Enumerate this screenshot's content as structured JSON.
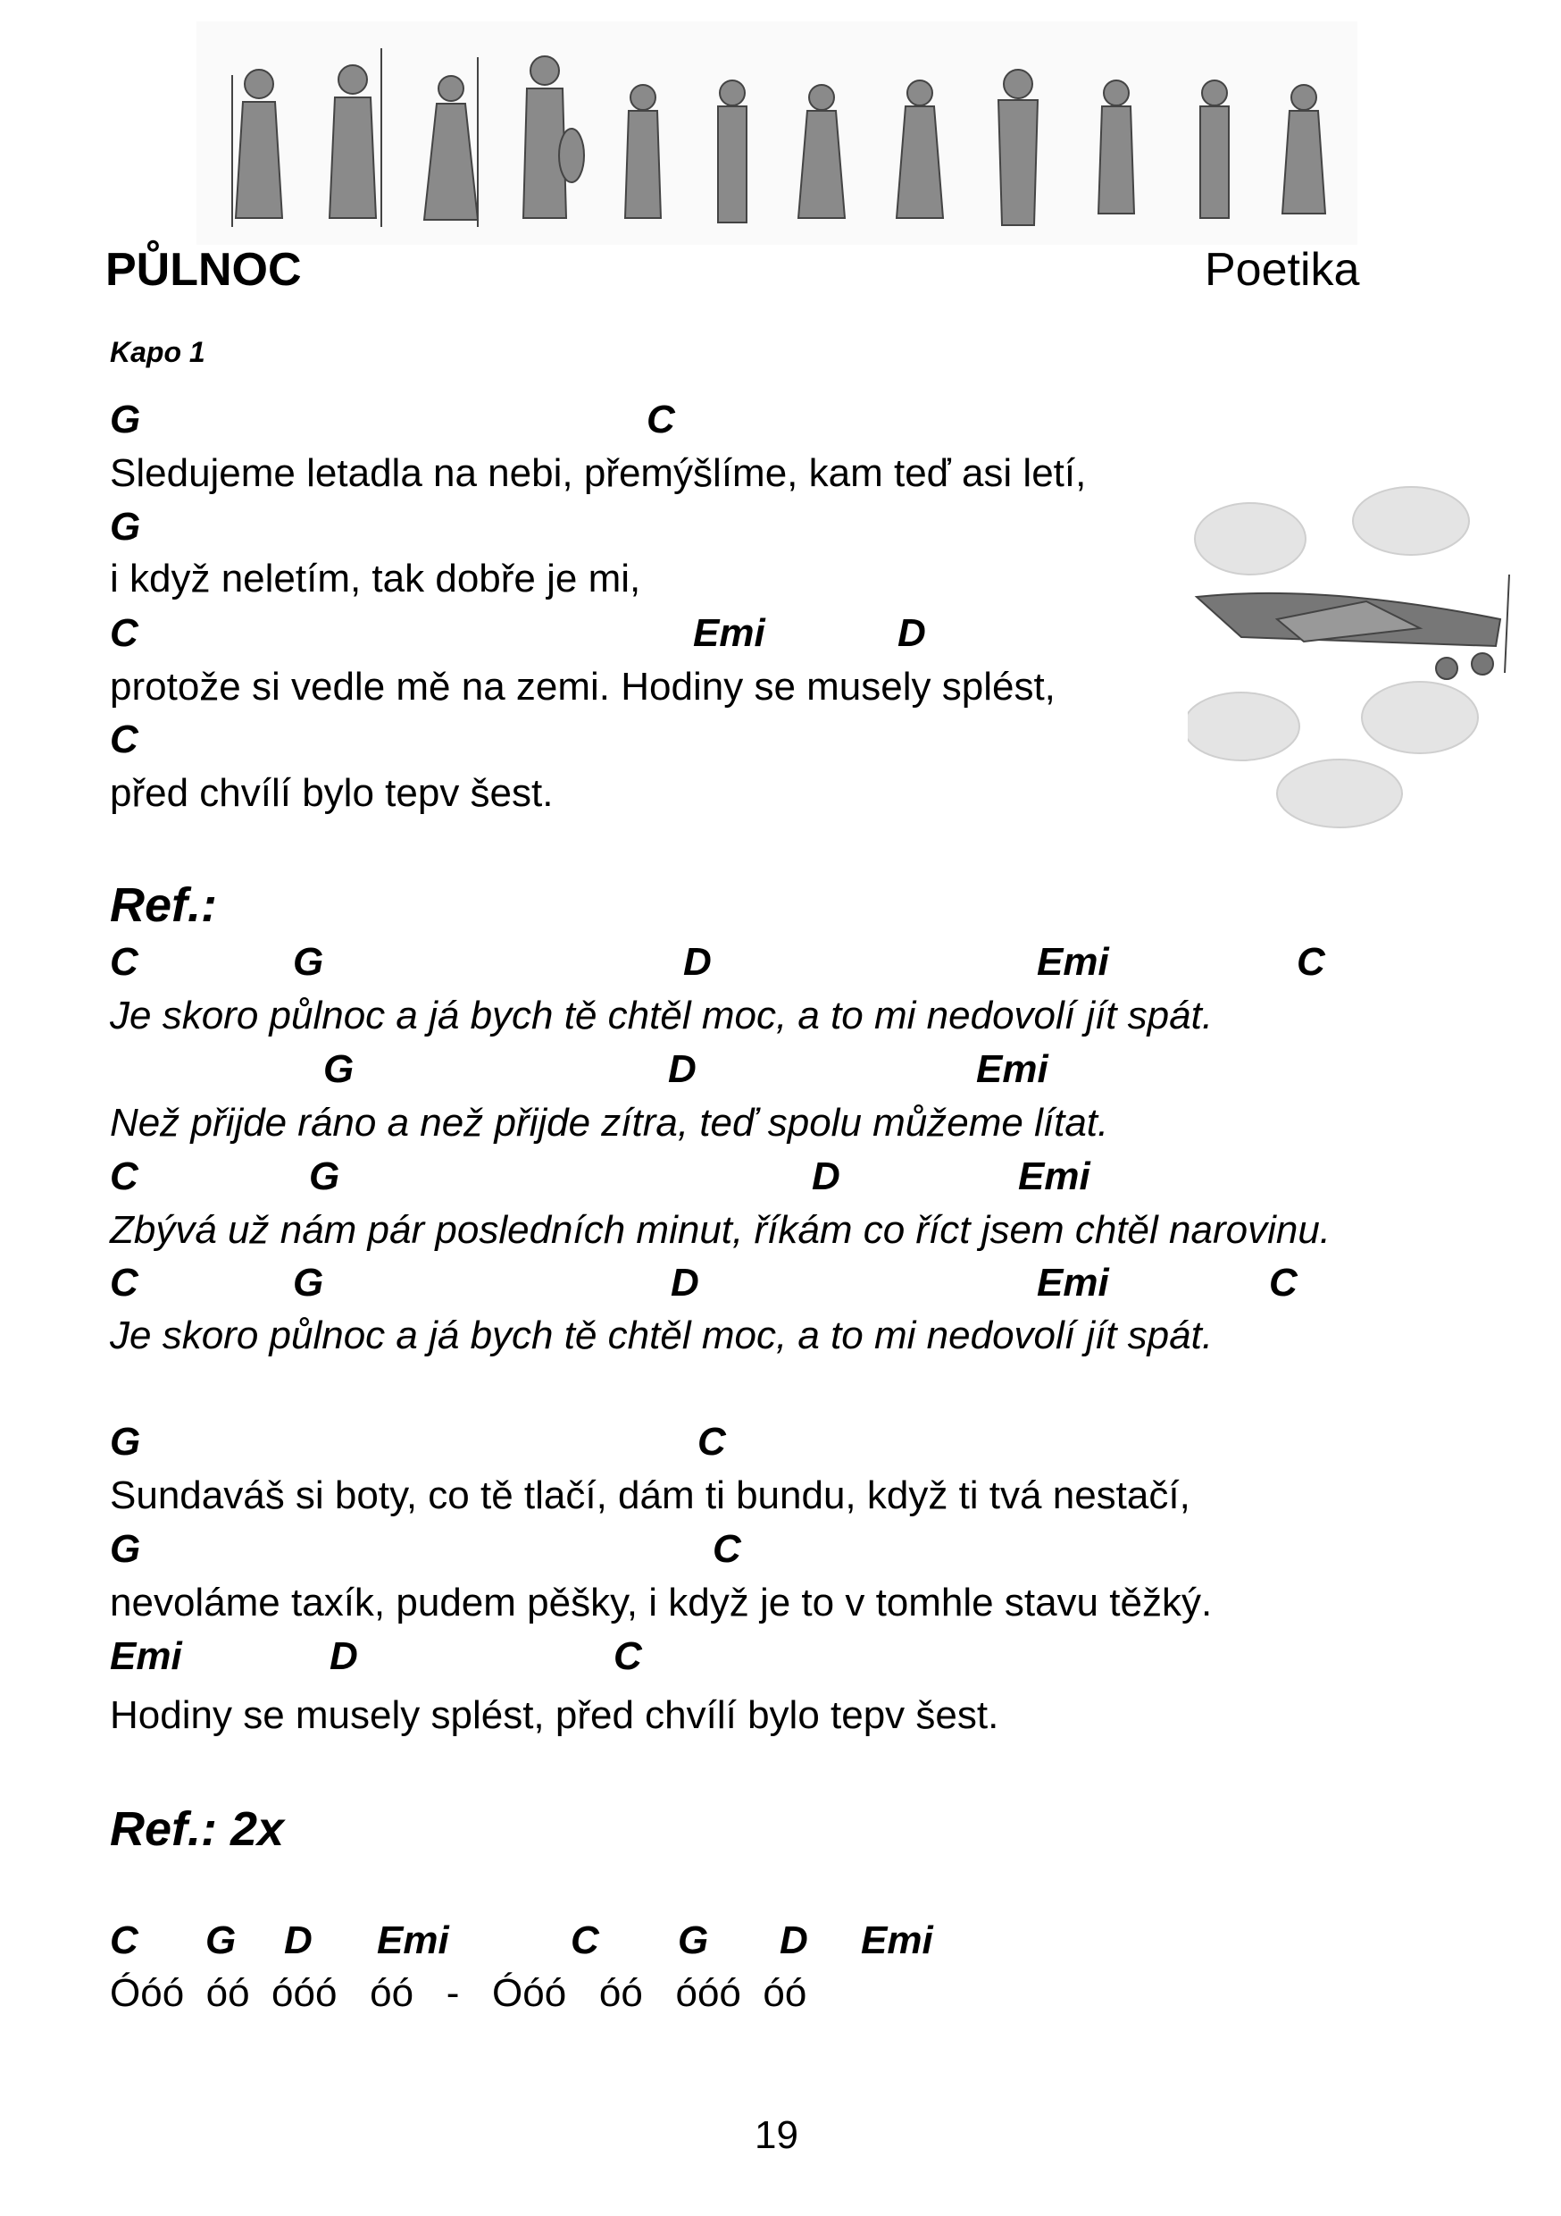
{
  "header": {
    "title": "PŮLNOC",
    "author": "Poetika",
    "capo": "Kapo 1"
  },
  "verse1": {
    "l1": {
      "chords": [
        "G",
        "C"
      ],
      "text": "Sledujeme letadla na nebi, přemýšlíme, kam teď asi letí,"
    },
    "l2": {
      "chords": [
        "G"
      ],
      "text": "i když neletím, tak dobře je mi,"
    },
    "l3": {
      "chords": [
        "C",
        "Emi",
        "D"
      ],
      "text": "protože si vedle mě na zemi. Hodiny se musely splést,"
    },
    "l4": {
      "chords": [
        "C"
      ],
      "text": "před chvílí bylo tepv šest."
    }
  },
  "chorus": {
    "label": "Ref.:",
    "l1": {
      "chords": [
        "C",
        "G",
        "D",
        "Emi",
        "C"
      ],
      "text": "Je skoro půlnoc a já bych tě chtěl moc, a to mi nedovolí jít spát."
    },
    "l2": {
      "chords": [
        "G",
        "D",
        "Emi"
      ],
      "text": "Než přijde ráno a než přijde zítra, teď spolu můžeme lítat."
    },
    "l3": {
      "chords": [
        "C",
        "G",
        "D",
        "Emi"
      ],
      "text": "Zbývá už nám pár posledních minut, říkám co říct jsem chtěl narovinu."
    },
    "l4": {
      "chords": [
        "C",
        "G",
        "D",
        "Emi",
        "C"
      ],
      "text": "Je skoro půlnoc a já bych tě chtěl moc, a to mi nedovolí jít spát."
    }
  },
  "verse2": {
    "l1": {
      "chords": [
        "G",
        "C"
      ],
      "text": "Sundaváš si boty, co tě tlačí, dám ti bundu, když ti tvá nestačí,"
    },
    "l2": {
      "chords": [
        "G",
        "C"
      ],
      "text": "nevoláme taxík, pudem pěšky, i když je to v tomhle stavu těžký."
    },
    "l3": {
      "chords": [
        "Emi",
        "D",
        "C"
      ],
      "text": "Hodiny se musely splést, před chvílí bylo tepv šest."
    }
  },
  "chorus2_label": "Ref.: 2x",
  "outro": {
    "chords": [
      "C",
      "G",
      "D",
      "Emi",
      "C",
      "G",
      "D",
      "Emi"
    ],
    "text": "Óóó  óó  óóó   óó   -   Óóó   óó   óóó  óó"
  },
  "page_number": "19",
  "images": {
    "header": "greek-gods-illustration",
    "side": "airplane-with-clouds-illustration"
  }
}
